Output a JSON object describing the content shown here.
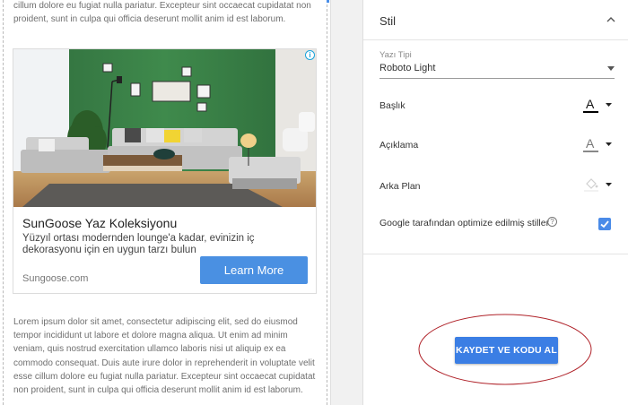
{
  "preview": {
    "lorem_top": "cillum dolore eu fugiat nulla pariatur. Excepteur sint occaecat cupidatat non proident, sunt in culpa qui officia deserunt mollit anim id est laborum.",
    "lorem_bottom": "Lorem ipsum dolor sit amet, consectetur adipiscing elit, sed do eiusmod tempor incididunt ut labore et dolore magna aliqua. Ut enim ad minim veniam, quis nostrud exercitation ullamco laboris nisi ut aliquip ex ea commodo consequat. Duis aute irure dolor in reprehenderit in voluptate velit esse cillum dolore eu fugiat nulla pariatur. Excepteur sint occaecat cupidatat non proident, sunt in culpa qui officia deserunt mollit anim id est laborum.",
    "ad": {
      "adchoices_icon": "info-icon",
      "title": "SunGoose Yaz Koleksiyonu",
      "description": "Yüzyıl ortası modernden lounge'a kadar, evinizin iç dekorasyonu için en uygun tarzı bulun",
      "domain": "Sungoose.com",
      "cta": "Learn More",
      "cta_color": "#4a90e2"
    }
  },
  "panel": {
    "section_title": "Stil",
    "collapse_icon": "chevron-up-icon",
    "font": {
      "label": "Yazı Tipi",
      "value": "Roboto Light"
    },
    "color_rows": [
      {
        "label": "Başlık",
        "color": "#000000",
        "icon": "text-color-icon"
      },
      {
        "label": "Açıklama",
        "color": "#888888",
        "icon": "text-color-icon"
      },
      {
        "label": "Arka Plan",
        "color": "#ffffff",
        "icon": "fill-color-icon"
      }
    ],
    "optimize": {
      "label": "Google tarafından optimize edilmiş stiller",
      "checked": true,
      "help_icon": "help-icon"
    },
    "save_label": "KAYDET VE KODU AL",
    "accent": "#3b7ee4",
    "highlight_color": "#b0232a"
  }
}
